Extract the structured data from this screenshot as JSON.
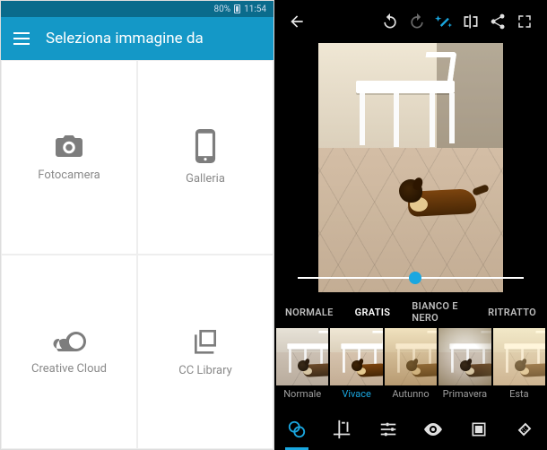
{
  "status": {
    "battery_pct": "80%",
    "time": "11:54"
  },
  "appbar": {
    "title": "Seleziona immagine da"
  },
  "sources": {
    "camera": "Fotocamera",
    "gallery": "Galleria",
    "cc": "Creative Cloud",
    "cclib": "CC Library"
  },
  "editor": {
    "categories": {
      "normal": "NORMALE",
      "free": "GRATIS",
      "bw": "BIANCO E NERO",
      "portrait": "RITRATTO"
    },
    "active_category": "free",
    "filters": {
      "normal": "Normale",
      "vivid": "Vivace",
      "autumn": "Autunno",
      "spring": "Primavera",
      "summer": "Esta"
    },
    "selected_filter": "vivid",
    "intensity": 0.52,
    "tools": {
      "looks": "Aspetti",
      "crop": "Ritaglia",
      "adjust": "Correzioni",
      "eye": "Occhi rossi",
      "frames": "Cornici",
      "heal": "Correggi"
    },
    "active_tool": "looks",
    "topbar": {
      "back": "back",
      "undo": "undo",
      "redo": "redo",
      "auto": "auto-enhance",
      "compare": "compare",
      "share": "share",
      "fullscreen": "fullscreen"
    }
  }
}
